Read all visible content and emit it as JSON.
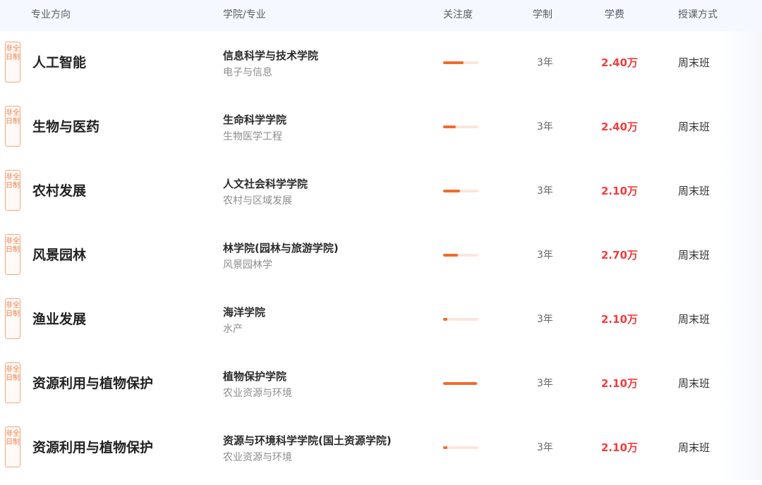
{
  "header": {
    "major": "专业方向",
    "college": "学院/专业",
    "attention": "关注度",
    "duration": "学制",
    "fee": "学费",
    "mode": "授课方式"
  },
  "colors": {
    "accent": "#f26a2b",
    "fee": "#f23c3c",
    "header_bg": "#f5f9ff"
  },
  "rows": [
    {
      "badge": "非全日制",
      "major": "人工智能",
      "college": "信息科学与技术学院",
      "sub": "电子与信息",
      "attention": 0.58,
      "duration": "3年",
      "fee": "2.40万",
      "mode": "周末班"
    },
    {
      "badge": "非全日制",
      "major": "生物与医药",
      "college": "生命科学学院",
      "sub": "生物医学工程",
      "attention": 0.36,
      "duration": "3年",
      "fee": "2.40万",
      "mode": "周末班"
    },
    {
      "badge": "非全日制",
      "major": "农村发展",
      "college": "人文社会科学学院",
      "sub": "农村与区域发展",
      "attention": 0.48,
      "duration": "3年",
      "fee": "2.10万",
      "mode": "周末班"
    },
    {
      "badge": "非全日制",
      "major": "风景园林",
      "college": "林学院(园林与旅游学院)",
      "sub": "风景园林学",
      "attention": 0.42,
      "duration": "3年",
      "fee": "2.70万",
      "mode": "周末班"
    },
    {
      "badge": "非全日制",
      "major": "渔业发展",
      "college": "海洋学院",
      "sub": "水产",
      "attention": 0.12,
      "duration": "3年",
      "fee": "2.10万",
      "mode": "周末班"
    },
    {
      "badge": "非全日制",
      "major": "资源利用与植物保护",
      "college": "植物保护学院",
      "sub": "农业资源与环境",
      "attention": 0.96,
      "duration": "3年",
      "fee": "2.10万",
      "mode": "周末班"
    },
    {
      "badge": "非全日制",
      "major": "资源利用与植物保护",
      "college": "资源与环境科学学院(国土资源学院)",
      "sub": "农业资源与环境",
      "attention": 0.12,
      "duration": "3年",
      "fee": "2.10万",
      "mode": "周末班"
    }
  ]
}
